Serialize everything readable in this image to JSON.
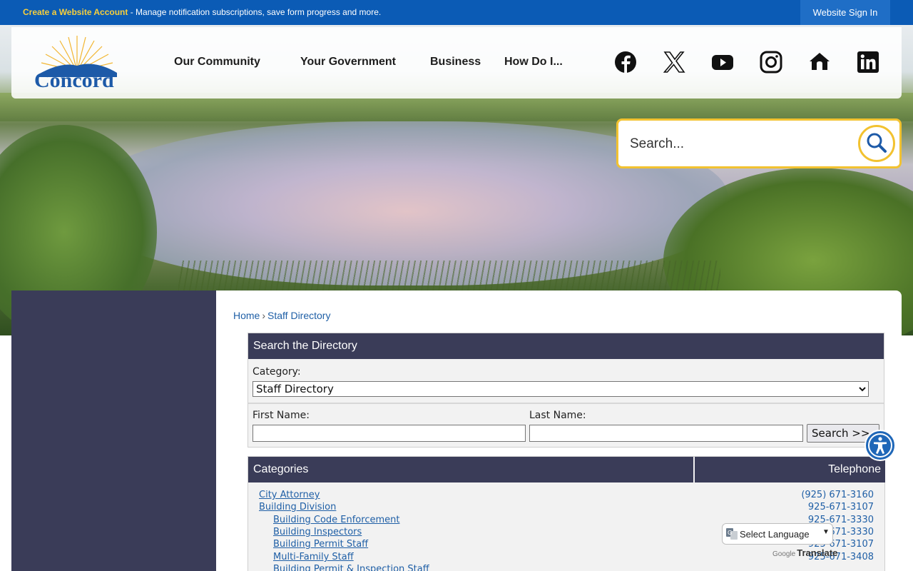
{
  "topbar": {
    "account_link": "Create a Website Account",
    "account_message": " - Manage notification subscriptions, save form progress and more.",
    "sign_in": "Website Sign In"
  },
  "logo": {
    "text": "Concord"
  },
  "nav": [
    {
      "label": "Our Community"
    },
    {
      "label": "Your Government"
    },
    {
      "label": "Business"
    },
    {
      "label": "How Do I..."
    }
  ],
  "social": [
    {
      "icon": "facebook-icon"
    },
    {
      "icon": "x-twitter-icon"
    },
    {
      "icon": "youtube-icon"
    },
    {
      "icon": "instagram-icon"
    },
    {
      "icon": "nextdoor-icon"
    },
    {
      "icon": "linkedin-icon"
    }
  ],
  "search": {
    "placeholder": "Search..."
  },
  "breadcrumb": {
    "home": "Home",
    "separator": "›",
    "current": "Staff Directory"
  },
  "directory": {
    "heading": "Search the Directory",
    "category_label": "Category:",
    "category_selected": "Staff Directory",
    "first_name_label": "First Name:",
    "last_name_label": "Last Name:",
    "search_button": "Search >>"
  },
  "table": {
    "col_categories": "Categories",
    "col_telephone": "Telephone",
    "rows": [
      {
        "name": "City Attorney",
        "phone": "(925) 671-3160",
        "indent": 0
      },
      {
        "name": "Building Division",
        "phone": "925-671-3107",
        "indent": 0
      },
      {
        "name": "Building Code Enforcement",
        "phone": "925-671-3330",
        "indent": 1
      },
      {
        "name": "Building Inspectors",
        "phone": "925-671-3330",
        "indent": 1
      },
      {
        "name": "Building Permit Staff",
        "phone": "925-671-3107",
        "indent": 1
      },
      {
        "name": "Multi-Family Staff",
        "phone": "925-671-3408",
        "indent": 1
      },
      {
        "name": "Building Permit & Inspection Staff",
        "phone": "",
        "indent": 1
      }
    ]
  },
  "translate": {
    "select_label": "Select Language",
    "powered_by": "Google",
    "translate_word": "Translate"
  },
  "colors": {
    "topbar": "#0b5bb5",
    "accent_yellow": "#f2c230",
    "navy_panel": "#3a3c58",
    "link_blue": "#1f5fa6"
  }
}
